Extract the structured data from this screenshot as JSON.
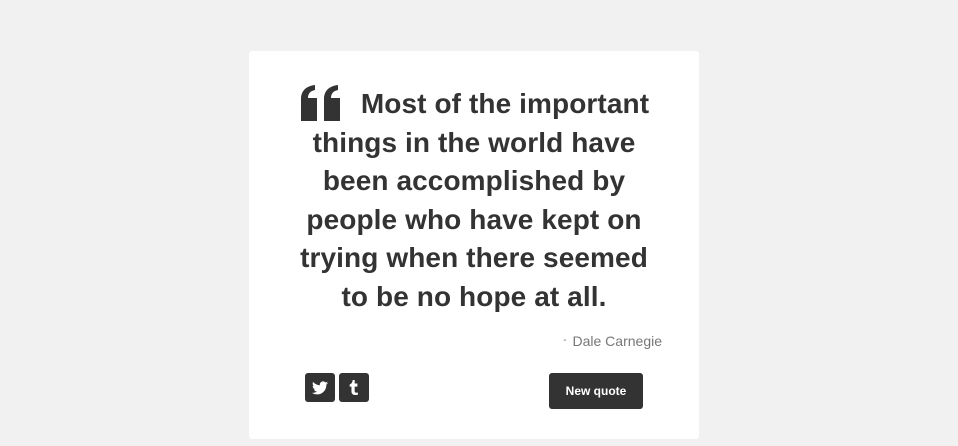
{
  "quote": {
    "text": "Most of the important things in the world have been accomplished by people who have kept on trying when there seemed to be no hope at all.",
    "author_prefix": "-",
    "author": "Dale Carnegie"
  },
  "actions": {
    "new_quote_label": "New quote",
    "twitter_icon": "twitter-icon",
    "tumblr_icon": "tumblr-icon"
  },
  "colors": {
    "background": "#f1f1f1",
    "card": "#ffffff",
    "accent": "#333333",
    "author_text": "#777777"
  }
}
